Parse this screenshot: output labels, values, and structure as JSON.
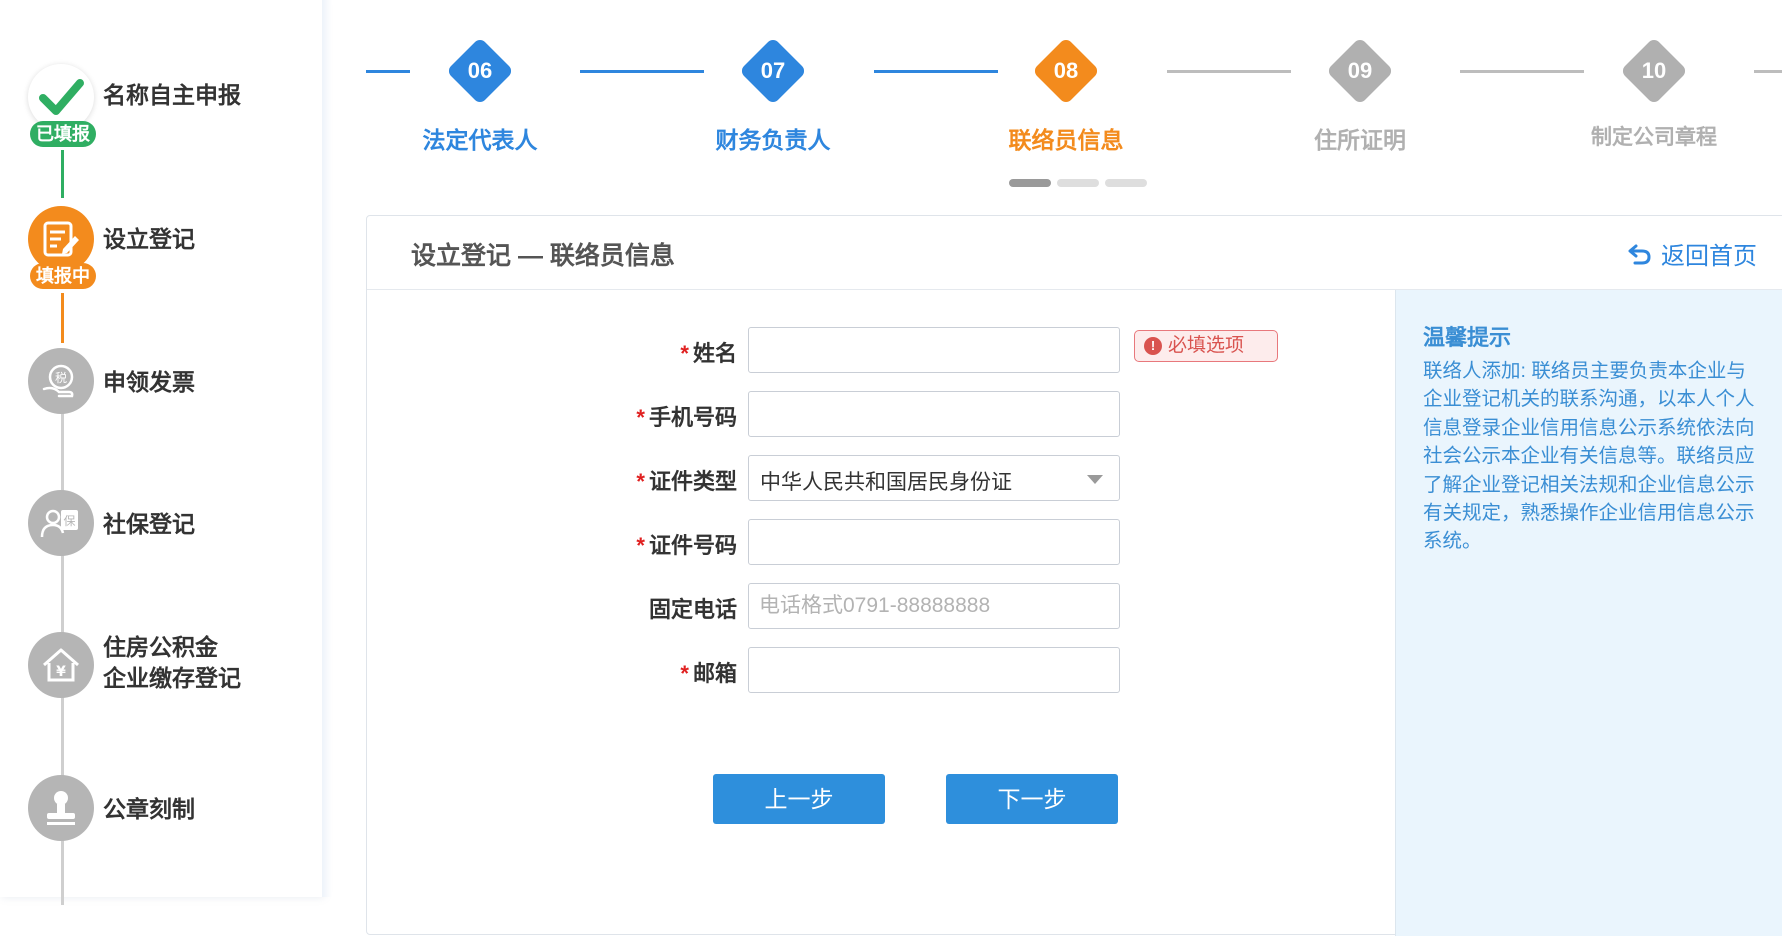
{
  "sidebar": {
    "items": [
      {
        "label": "名称自主申报",
        "badge": "已填报",
        "status": "done",
        "icon": "check-icon"
      },
      {
        "label": "设立登记",
        "badge": "填报中",
        "status": "active",
        "icon": "edit-form-icon"
      },
      {
        "label": "申领发票",
        "icon": "tax-hand-icon"
      },
      {
        "label": "社保登记",
        "icon": "social-insurance-icon"
      },
      {
        "label": "住房公积金",
        "label2": "企业缴存登记",
        "icon": "housing-fund-icon"
      },
      {
        "label": "公章刻制",
        "icon": "stamp-icon"
      }
    ]
  },
  "stepper": {
    "steps": [
      {
        "num": "06",
        "label": "法定代表人",
        "state": "done"
      },
      {
        "num": "07",
        "label": "财务负责人",
        "state": "done"
      },
      {
        "num": "08",
        "label": "联络员信息",
        "state": "current"
      },
      {
        "num": "09",
        "label": "住所证明",
        "state": "todo"
      },
      {
        "num": "10",
        "label": "制定公司章程",
        "state": "todo"
      }
    ]
  },
  "card": {
    "title": "设立登记 — 联络员信息",
    "back_label": "返回首页"
  },
  "form": {
    "required_mark": "*",
    "name_label": "姓名",
    "name_value": "",
    "name_error": "必填选项",
    "phone_label": "手机号码",
    "phone_value": "",
    "idtype_label": "证件类型",
    "idtype_value": "中华人民共和国居民身份证",
    "idnum_label": "证件号码",
    "idnum_value": "",
    "tel_label": "固定电话",
    "tel_placeholder": "电话格式0791-88888888",
    "email_label": "邮箱",
    "email_value": ""
  },
  "buttons": {
    "prev": "上一步",
    "next": "下一步"
  },
  "tips": {
    "title": "温馨提示",
    "body": "联络人添加: 联络员主要负责本企业与企业登记机关的联系沟通，以本人个人信息登录企业信用信息公示系统依法向社会公示本企业有关信息等。联络员应了解企业登记相关法规和企业信息公示有关规定，熟悉操作企业信用信息公示系统。"
  },
  "colors": {
    "primary": "#2e8fdc",
    "orange": "#f38b1d",
    "green": "#2fae62",
    "gray": "#b5b5b5",
    "tips_bg": "#eaf5fd"
  }
}
